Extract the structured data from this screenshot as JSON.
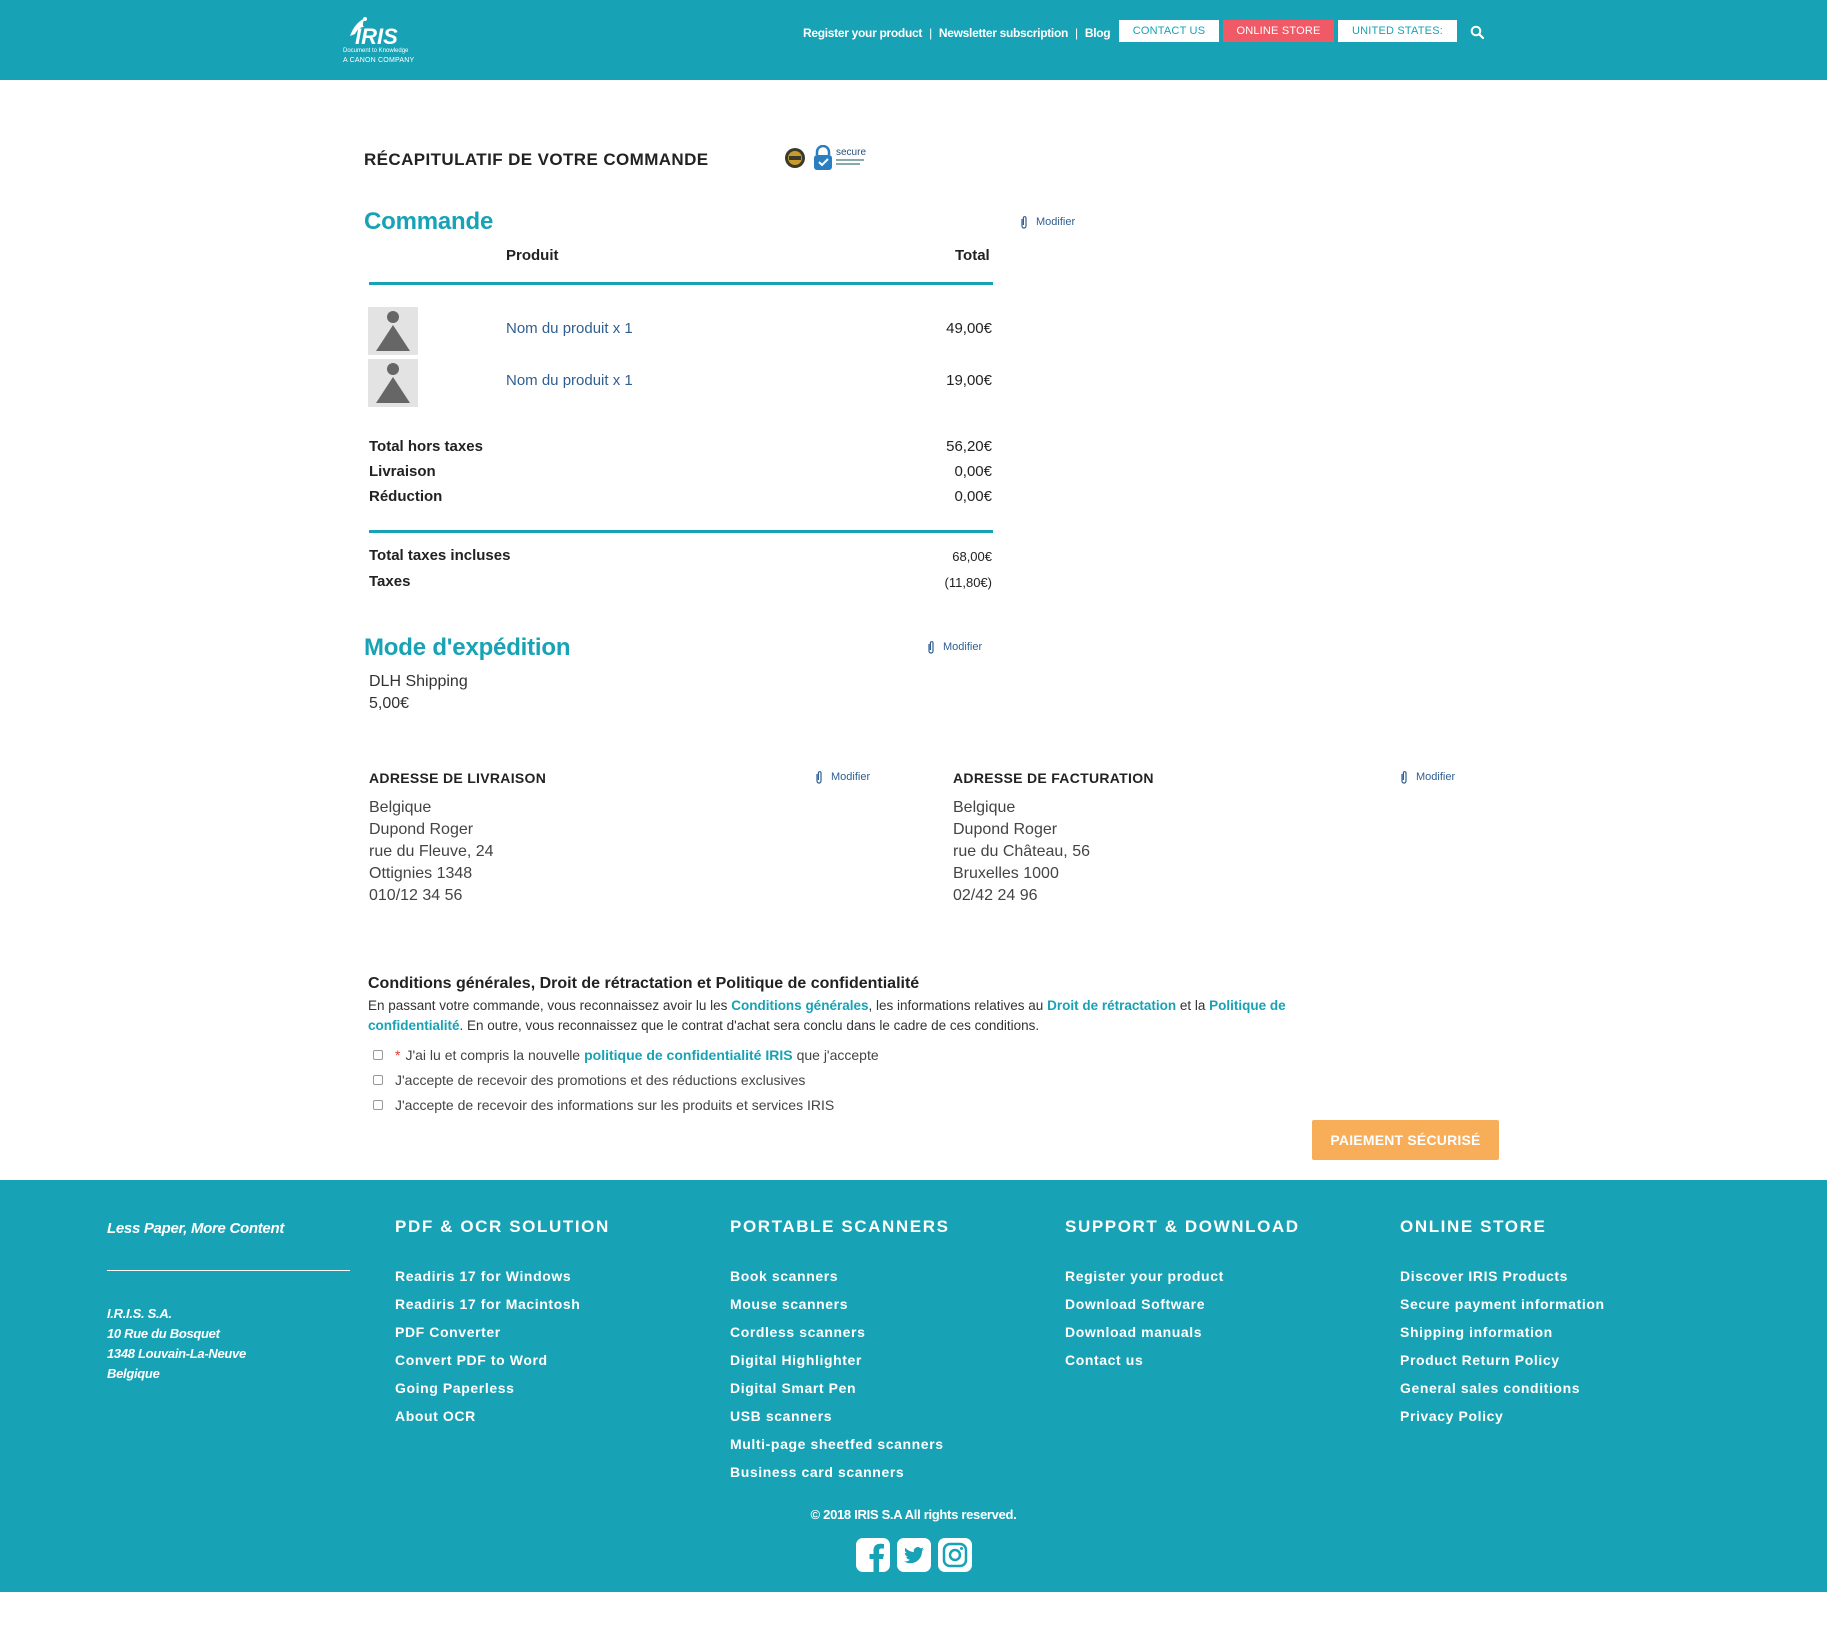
{
  "header": {
    "logo_brand": "IRIS",
    "logo_tagline": "Document to Knowledge",
    "logo_company": "A CANON COMPANY",
    "links": [
      "Register your product",
      "Newsletter subscription",
      "Blog"
    ],
    "contact_label": "CONTACT US",
    "store_label": "ONLINE STORE",
    "country_label": "UNITED STATES:",
    "colors": {
      "primary": "#17a2b5",
      "store": "#f05a66"
    }
  },
  "page": {
    "recap_title": "RÉCAPITULATIF DE VOTRE COMMANDE",
    "badge_secure": "secure"
  },
  "order": {
    "title": "Commande",
    "modifier": "Modifier",
    "col_product": "Produit",
    "col_total": "Total",
    "items": [
      {
        "name": "Nom du produit x 1",
        "price": "49,00€"
      },
      {
        "name": "Nom du produit x 1",
        "price": "19,00€"
      }
    ],
    "summary": [
      {
        "label": "Total hors taxes",
        "value": "56,20€"
      },
      {
        "label": "Livraison",
        "value": "0,00€"
      },
      {
        "label": "Réduction",
        "value": "0,00€"
      }
    ],
    "totals": [
      {
        "label": "Total taxes incluses",
        "value": "68,00€"
      },
      {
        "label": "Taxes",
        "value": "(11,80€)"
      }
    ]
  },
  "shipping": {
    "title": "Mode d'expédition",
    "modifier": "Modifier",
    "method": "DLH Shipping",
    "price": "5,00€"
  },
  "delivery_address": {
    "title": "ADRESSE DE LIVRAISON",
    "modifier": "Modifier",
    "lines": [
      "Belgique",
      "Dupond Roger",
      "rue du Fleuve, 24",
      "Ottignies 1348",
      "010/12 34 56"
    ]
  },
  "billing_address": {
    "title": "ADRESSE DE FACTURATION",
    "modifier": "Modifier",
    "lines": [
      "Belgique",
      "Dupond Roger",
      "rue du Château, 56",
      "Bruxelles 1000",
      "02/42 24 96"
    ]
  },
  "conditions": {
    "title": "Conditions générales, Droit de rétractation et Politique de confidentialité",
    "text_1": "En passant votre commande, vous reconnaissez avoir lu les",
    "link_conditions": "Conditions générales",
    "text_2": ", les informations relatives au",
    "link_retractation": "Droit de rétractation",
    "text_3": "et la",
    "link_privacy": "Politique de confidentialité",
    "text_4": ". En outre, vous reconnaissez que le contrat d'achat sera conclu dans le cadre de ces conditions.",
    "check1_star": "*",
    "check1_pre": "J'ai lu et compris la nouvelle",
    "check1_link": "politique de confidentialité IRIS",
    "check1_post": "que j'accepte",
    "check2": "J'accepte de recevoir des promotions et des réductions exclusives",
    "check3": "J'accepte de recevoir des informations sur les produits et services IRIS",
    "pay_button": "PAIEMENT SÉCURISÉ"
  },
  "footer": {
    "slogan": "Less Paper, More Content",
    "address": [
      "I.R.I.S. S.A.",
      "10 Rue du Bosquet",
      "1348 Louvain-La-Neuve",
      "Belgique"
    ],
    "columns": [
      {
        "title": "PDF & OCR SOLUTION",
        "links": [
          "Readiris 17 for Windows",
          "Readiris 17 for Macintosh",
          "PDF Converter",
          "Convert PDF to Word",
          "Going Paperless",
          "About OCR"
        ]
      },
      {
        "title": "PORTABLE SCANNERS",
        "links": [
          "Book scanners",
          "Mouse scanners",
          "Cordless scanners",
          "Digital Highlighter",
          "Digital Smart Pen",
          "USB scanners",
          "Multi-page sheetfed scanners",
          "Business card scanners"
        ]
      },
      {
        "title": "SUPPORT & DOWNLOAD",
        "links": [
          "Register your product",
          "Download Software",
          "Download manuals",
          "Contact us"
        ]
      },
      {
        "title": "ONLINE STORE",
        "links": [
          "Discover IRIS Products",
          "Secure payment information",
          "Shipping information",
          "Product Return Policy",
          "General sales conditions",
          "Privacy Policy"
        ]
      }
    ],
    "copyright": "© 2018 IRIS S.A All rights reserved.",
    "social_icons": [
      "facebook-icon",
      "twitter-icon",
      "instagram-icon"
    ]
  }
}
